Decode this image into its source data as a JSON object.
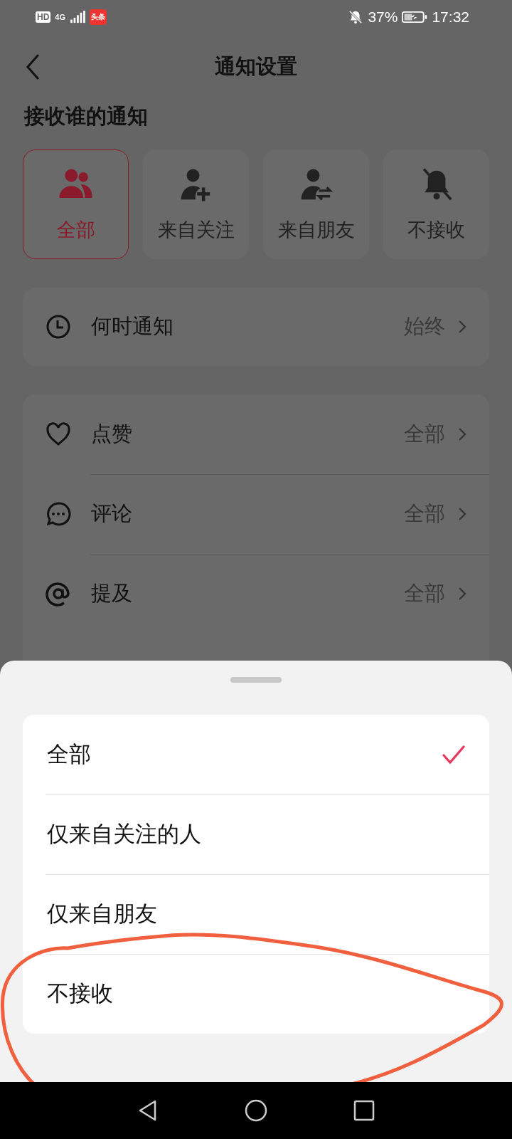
{
  "status_bar": {
    "network_badges": [
      "HD",
      "4G"
    ],
    "app_badge": "头条",
    "battery": "37%",
    "time": "17:32"
  },
  "header": {
    "title": "通知设置"
  },
  "who_section": {
    "title": "接收谁的通知",
    "options": [
      {
        "label": "全部",
        "kind": "everyone",
        "selected": true
      },
      {
        "label": "来自关注",
        "kind": "following",
        "selected": false
      },
      {
        "label": "来自朋友",
        "kind": "friends",
        "selected": false
      },
      {
        "label": "不接收",
        "kind": "none",
        "selected": false
      }
    ]
  },
  "when_row": {
    "label": "何时通知",
    "value": "始终"
  },
  "settings": [
    {
      "kind": "like",
      "label": "点赞",
      "value": "全部"
    },
    {
      "kind": "comment",
      "label": "评论",
      "value": "全部"
    },
    {
      "kind": "mention",
      "label": "提及",
      "value": "全部"
    }
  ],
  "sheet": {
    "options": [
      {
        "label": "全部",
        "selected": true
      },
      {
        "label": "仅来自关注的人",
        "selected": false
      },
      {
        "label": "仅来自朋友",
        "selected": false
      },
      {
        "label": "不接收",
        "selected": false
      }
    ]
  }
}
